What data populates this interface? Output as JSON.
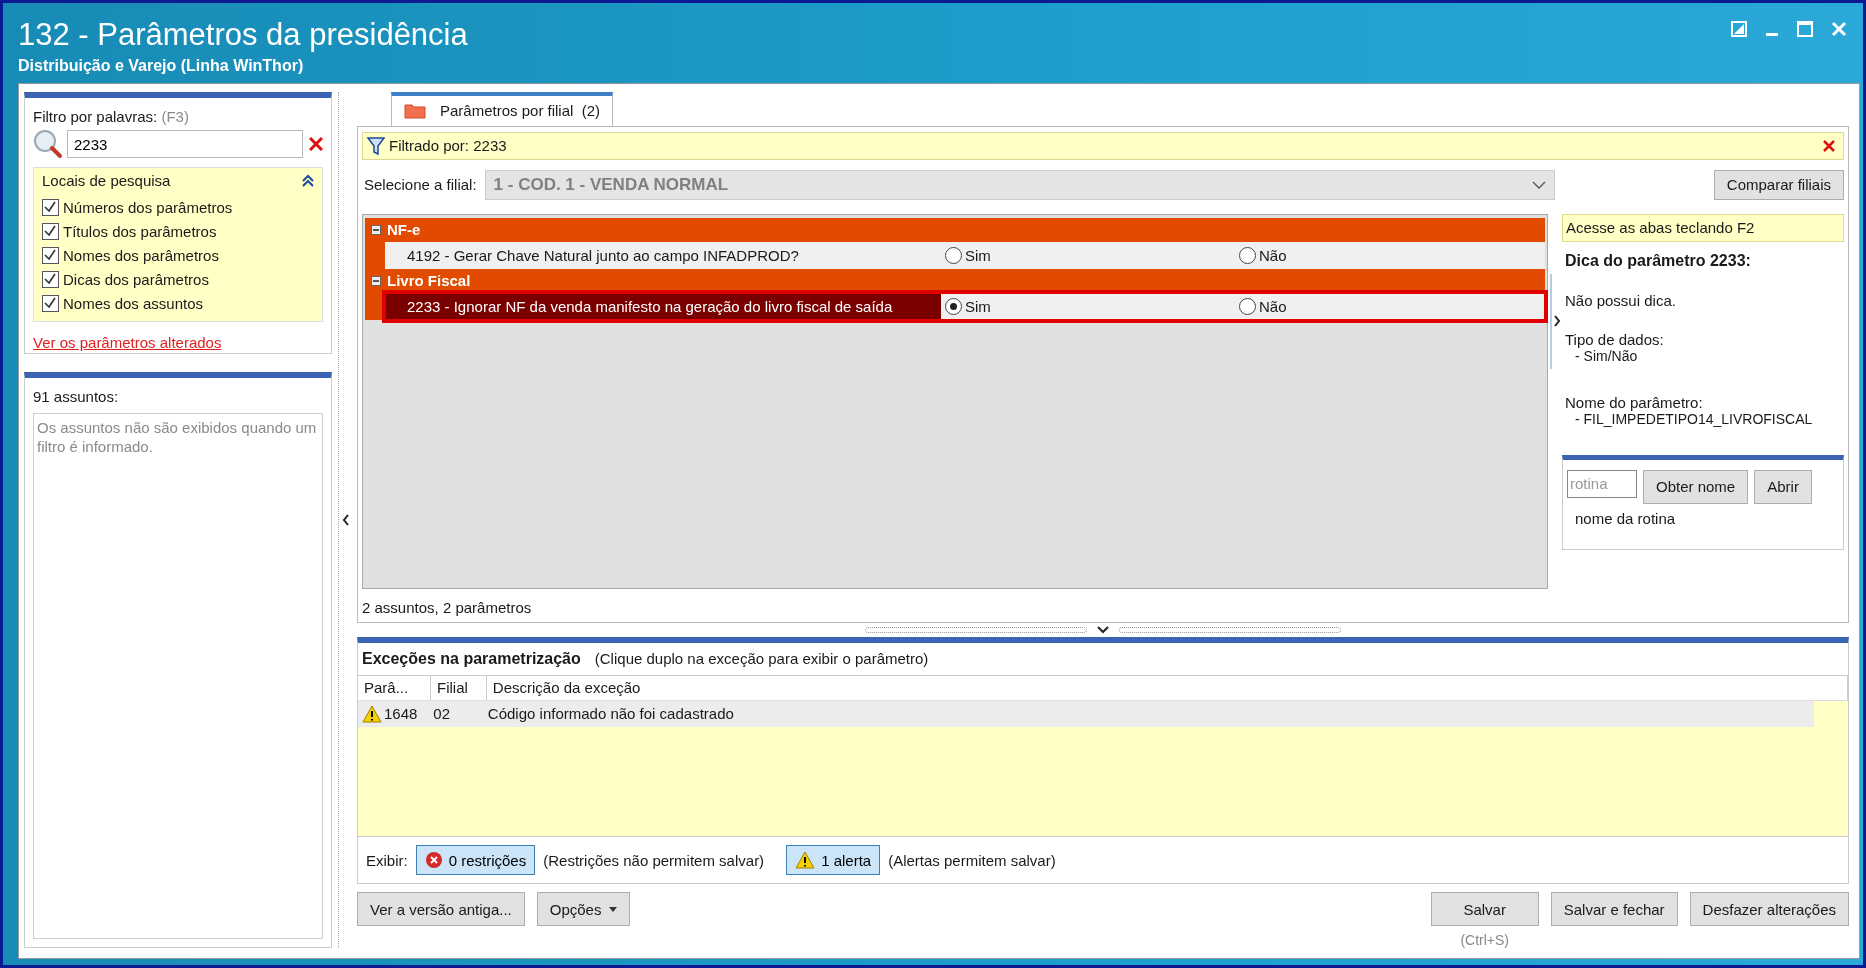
{
  "window": {
    "title": "132 - Parâmetros da presidência",
    "subtitle": "Distribuição e Varejo (Linha WinThor)"
  },
  "filter": {
    "label": "Filtro por palavras:",
    "shortcut": "(F3)",
    "value": "2233"
  },
  "search_locations": {
    "title": "Locais de pesquisa",
    "expanded": true,
    "items": [
      {
        "label": "Números dos parâmetros",
        "checked": true
      },
      {
        "label": "Títulos dos parâmetros",
        "checked": true
      },
      {
        "label": "Nomes dos parâmetros",
        "checked": true
      },
      {
        "label": "Dicas dos parâmetros",
        "checked": true
      },
      {
        "label": "Nomes dos assuntos",
        "checked": true
      }
    ]
  },
  "changed_link": "Ver os parâmetros alterados",
  "subjects": {
    "title": "91 assuntos:",
    "message": "Os assuntos não são exibidos quando um filtro é informado."
  },
  "tabs": [
    {
      "label": "Parâmetros por filial",
      "count": "(2)",
      "selected": true
    }
  ],
  "filter_bar": {
    "text": "Filtrado por: 2233"
  },
  "branch": {
    "label": "Selecione a filial:",
    "value": "1 - COD. 1 - VENDA NORMAL",
    "disabled": true
  },
  "compare_button": "Comparar filiais",
  "groups": [
    {
      "name": "NF-e",
      "expanded": true,
      "params": [
        {
          "label": "4192 - Gerar Chave Natural junto ao campo INFADPROD?",
          "selected": false,
          "highlighted": false,
          "options": [
            {
              "label": "Sim",
              "selected": false
            },
            {
              "label": "Não",
              "selected": false
            }
          ]
        }
      ]
    },
    {
      "name": "Livro Fiscal",
      "expanded": true,
      "params": [
        {
          "label": "2233 - Ignorar NF da venda manifesto na geração do livro fiscal de saída",
          "selected": true,
          "highlighted": true,
          "options": [
            {
              "label": "Sim",
              "selected": true
            },
            {
              "label": "Não",
              "selected": false
            }
          ]
        }
      ]
    }
  ],
  "grid_status": "2 assuntos, 2 parâmetros",
  "hint_panel": {
    "banner": "Acesse as abas teclando F2",
    "title": "Dica do parâmetro 2233:",
    "blocks": [
      {
        "kind": "text",
        "text": "Não possui dica."
      },
      {
        "kind": "field",
        "label": "Tipo de dados:",
        "value": "- Sim/Não"
      },
      {
        "kind": "field",
        "label": "Nome do parâmetro:",
        "value": "- FIL_IMPEDETIPO14_LIVROFISCAL"
      }
    ]
  },
  "routine": {
    "placeholder": "rotina",
    "buttons": [
      "Obter nome",
      "Abrir"
    ],
    "caption": "nome da rotina"
  },
  "exceptions": {
    "title": "Exceções na parametrização",
    "hint": "(Clique duplo na exceção para exibir o parâmetro)",
    "columns": [
      "Parâ...",
      "Filial",
      "Descrição da exceção"
    ],
    "rows": [
      {
        "kind": "alert",
        "cells": [
          "1648",
          "02",
          "Código informado não foi cadastrado"
        ]
      }
    ],
    "show_label": "Exibir:",
    "filters": [
      {
        "kind": "restriction",
        "label": "0 restrições",
        "selected": true,
        "note": "(Restrições não permitem salvar)"
      },
      {
        "kind": "alert",
        "label": "1 alerta",
        "selected": true,
        "note": "(Alertas permitem salvar)"
      }
    ]
  },
  "buttons_left": [
    {
      "label": "Ver a versão antiga...",
      "dropdown": false
    },
    {
      "label": "Opções",
      "dropdown": true
    }
  ],
  "buttons_right": [
    {
      "label": "Salvar",
      "shortcut": "(Ctrl+S)"
    },
    {
      "label": "Salvar e fechar"
    },
    {
      "label": "Desfazer alterações"
    }
  ]
}
